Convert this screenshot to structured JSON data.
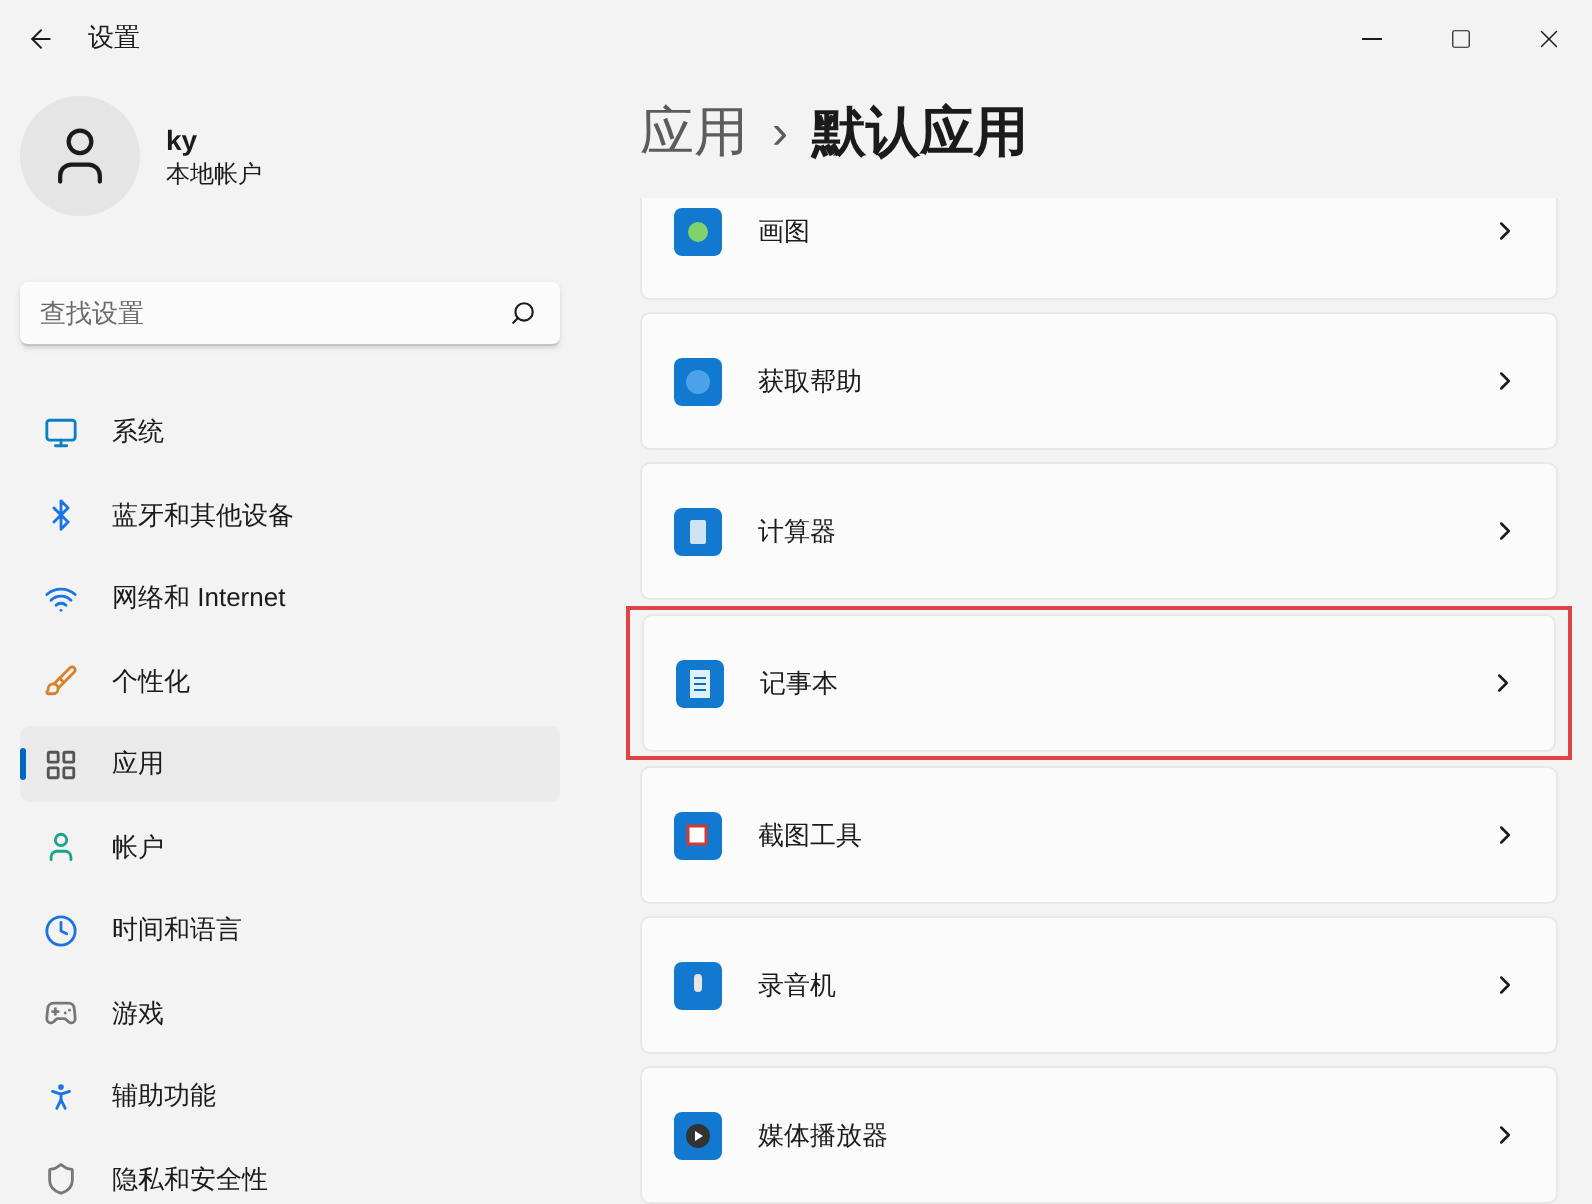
{
  "window": {
    "title": "设置"
  },
  "profile": {
    "name": "ky",
    "account_type": "本地帐户"
  },
  "search": {
    "placeholder": "查找设置"
  },
  "nav": [
    {
      "label": "系统",
      "selected": false
    },
    {
      "label": "蓝牙和其他设备",
      "selected": false
    },
    {
      "label": "网络和 Internet",
      "selected": false
    },
    {
      "label": "个性化",
      "selected": false
    },
    {
      "label": "应用",
      "selected": true
    },
    {
      "label": "帐户",
      "selected": false
    },
    {
      "label": "时间和语言",
      "selected": false
    },
    {
      "label": "游戏",
      "selected": false
    },
    {
      "label": "辅助功能",
      "selected": false
    },
    {
      "label": "隐私和安全性",
      "selected": false
    }
  ],
  "breadcrumb": {
    "parent": "应用",
    "separator": "›",
    "current": "默认应用"
  },
  "apps": [
    {
      "name": "画图",
      "highlighted": false
    },
    {
      "name": "获取帮助",
      "highlighted": false
    },
    {
      "name": "计算器",
      "highlighted": false
    },
    {
      "name": "记事本",
      "highlighted": true
    },
    {
      "name": "截图工具",
      "highlighted": false
    },
    {
      "name": "录音机",
      "highlighted": false
    },
    {
      "name": "媒体播放器",
      "highlighted": false
    }
  ]
}
